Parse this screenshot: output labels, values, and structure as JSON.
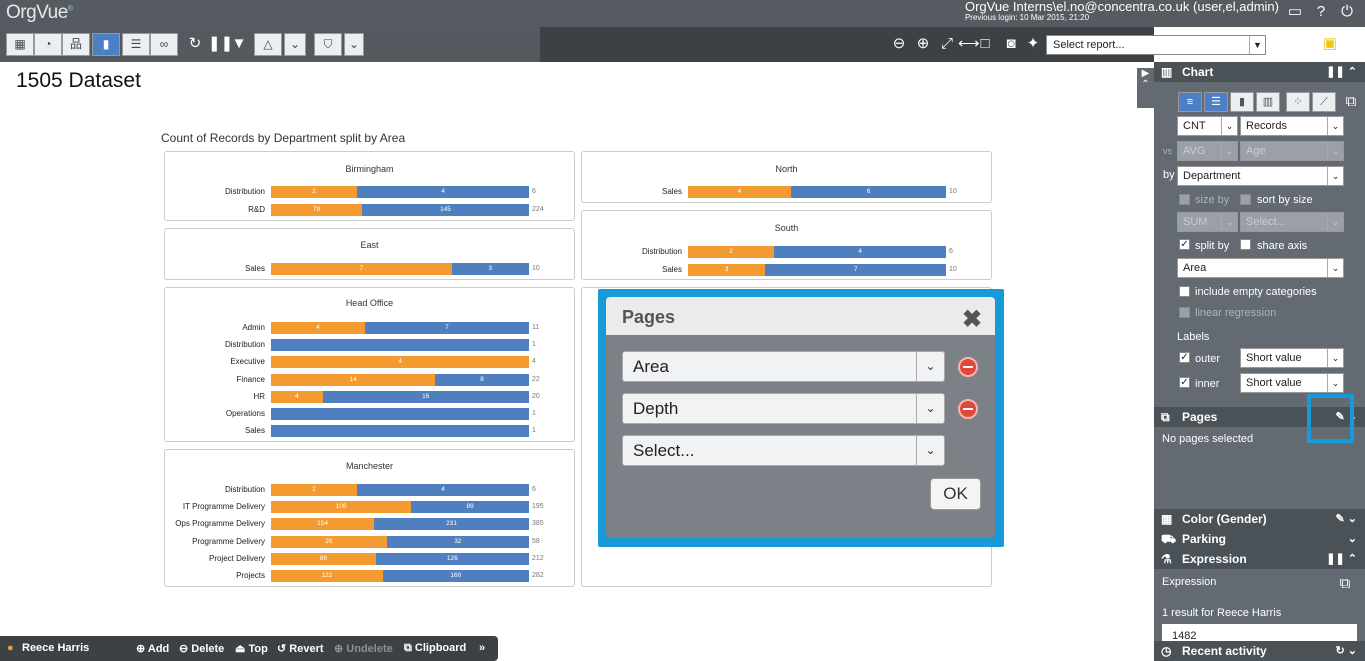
{
  "app": {
    "logo": "OrgVue",
    "logo_mark": "®",
    "user": "OrgVue Interns\\el.no@concentra.co.uk (user,el,admin)",
    "last_login": "Previous login: 10 Mar 2015, 21:20"
  },
  "toolbar": {
    "report_placeholder": "Select report..."
  },
  "page": {
    "title": "1505 Dataset"
  },
  "chart": {
    "title": "Count of Records by Department split by Area"
  },
  "chart_data": {
    "type": "bar",
    "title": "Count of Records by Department split by Area",
    "series_colors": {
      "first": "#f39a31",
      "second": "#4f7fbf"
    },
    "panels": [
      {
        "name": "Birmingham",
        "rows": [
          {
            "label": "Distribution",
            "values": [
              2,
              4
            ],
            "total": 6
          },
          {
            "label": "R&D",
            "values": [
              79,
              145
            ],
            "total": 224
          }
        ]
      },
      {
        "name": "North",
        "rows": [
          {
            "label": "Sales",
            "values": [
              4,
              6
            ],
            "total": 10
          }
        ]
      },
      {
        "name": "East",
        "rows": [
          {
            "label": "Sales",
            "values": [
              7,
              3
            ],
            "total": 10
          }
        ]
      },
      {
        "name": "South",
        "rows": [
          {
            "label": "Distribution",
            "values": [
              2,
              4
            ],
            "total": 6
          },
          {
            "label": "Sales",
            "values": [
              3,
              7
            ],
            "total": 10
          }
        ]
      },
      {
        "name": "Head Office",
        "rows": [
          {
            "label": "Admin",
            "values": [
              4,
              7
            ],
            "total": 11
          },
          {
            "label": "Distribution",
            "values": [
              0,
              1
            ],
            "total": 1
          },
          {
            "label": "Executive",
            "values": [
              4,
              0
            ],
            "total": 4
          },
          {
            "label": "Finance",
            "values": [
              14,
              8
            ],
            "total": 22
          },
          {
            "label": "HR",
            "values": [
              4,
              16
            ],
            "total": 20
          },
          {
            "label": "Operations",
            "values": [
              0,
              1
            ],
            "total": 1
          },
          {
            "label": "Sales",
            "values": [
              0,
              1
            ],
            "total": 1
          }
        ]
      },
      {
        "name": "Manchester",
        "rows": [
          {
            "label": "Distribution",
            "values": [
              2,
              4
            ],
            "total": 6
          },
          {
            "label": "IT Programme Delivery",
            "values": [
              106,
              89
            ],
            "total": 195
          },
          {
            "label": "Ops Programme Delivery",
            "values": [
              154,
              231
            ],
            "total": 385
          },
          {
            "label": "Programme Delivery",
            "values": [
              26,
              32
            ],
            "total": 58
          },
          {
            "label": "Project Delivery",
            "values": [
              86,
              126
            ],
            "total": 212
          },
          {
            "label": "Projects",
            "values": [
              122,
              160
            ],
            "total": 282
          }
        ]
      }
    ]
  },
  "dialog": {
    "title": "Pages",
    "fields": [
      {
        "value": "Area"
      },
      {
        "value": "Depth"
      },
      {
        "value": "Select..."
      }
    ],
    "ok_label": "OK"
  },
  "side": {
    "chart_header": "Chart",
    "measure": {
      "func": "CNT",
      "field": "Records"
    },
    "vs": {
      "label": "vs",
      "func": "AVG",
      "field": "Age"
    },
    "by": {
      "label": "by",
      "field": "Department"
    },
    "size_by": "size by",
    "sort_by_size": "sort by size",
    "size_func": "SUM",
    "size_field": "Select...",
    "split_by": "split by",
    "share_axis": "share axis",
    "split_field": "Area",
    "include_empty": "include empty categories",
    "linear_regression": "linear regression",
    "labels_title": "Labels",
    "outer_label": "outer",
    "outer_value": "Short value",
    "inner_label": "inner",
    "inner_value": "Short value",
    "pages_header": "Pages",
    "pages_empty": "No pages selected",
    "color_header": "Color (Gender)",
    "parking_header": "Parking",
    "expression_header": "Expression",
    "expression_label": "Expression",
    "expression_result": "1 result for Reece Harris",
    "expression_value": "1482",
    "recent_header": "Recent activity"
  },
  "bottom": {
    "record": "Reece Harris",
    "add": "Add",
    "delete": "Delete",
    "top": "Top",
    "revert": "Revert",
    "undelete": "Undelete",
    "clipboard": "Clipboard"
  }
}
